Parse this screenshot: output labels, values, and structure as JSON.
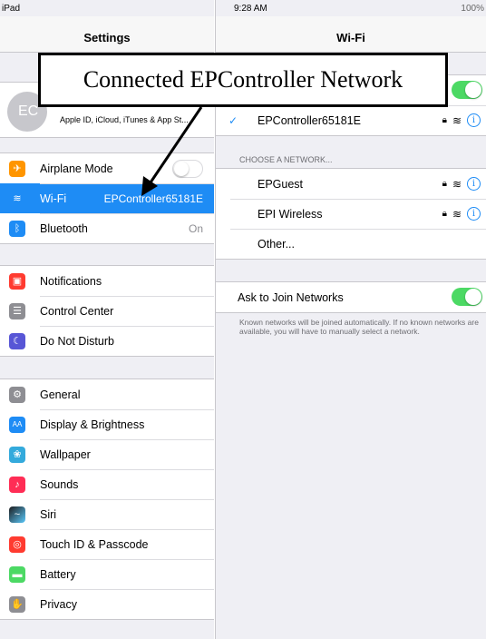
{
  "status_bar": {
    "carrier": "iPad",
    "time": "9:28 AM",
    "battery": "100%"
  },
  "left": {
    "title": "Settings",
    "profile": {
      "initials": "EC",
      "subtitle": "Apple ID, iCloud, iTunes & App St..."
    },
    "group1": [
      {
        "label": "Airplane Mode",
        "icon": "airplane-icon",
        "color": "#ff9500",
        "toggle": "off"
      },
      {
        "label": "Wi-Fi",
        "icon": "wifi-icon",
        "color": "#1e8cf5",
        "value": "EPController65181E",
        "selected": true
      },
      {
        "label": "Bluetooth",
        "icon": "bluetooth-icon",
        "color": "#1e8cf5",
        "value": "On"
      }
    ],
    "group2": [
      {
        "label": "Notifications",
        "icon": "notifications-icon",
        "color": "#ff3b30"
      },
      {
        "label": "Control Center",
        "icon": "control-center-icon",
        "color": "#8e8e93"
      },
      {
        "label": "Do Not Disturb",
        "icon": "moon-icon",
        "color": "#5856d6"
      }
    ],
    "group3": [
      {
        "label": "General",
        "icon": "gear-icon",
        "color": "#8e8e93"
      },
      {
        "label": "Display & Brightness",
        "icon": "display-icon",
        "color": "#1e8cf5"
      },
      {
        "label": "Wallpaper",
        "icon": "wallpaper-icon",
        "color": "#34aadc"
      },
      {
        "label": "Sounds",
        "icon": "sounds-icon",
        "color": "#ff2d55"
      },
      {
        "label": "Siri",
        "icon": "siri-icon",
        "color": "#1c1c1e"
      },
      {
        "label": "Touch ID & Passcode",
        "icon": "fingerprint-icon",
        "color": "#ff3b30"
      },
      {
        "label": "Battery",
        "icon": "battery-icon",
        "color": "#4cd964"
      },
      {
        "label": "Privacy",
        "icon": "hand-icon",
        "color": "#8e8e93"
      }
    ]
  },
  "right": {
    "title": "Wi-Fi",
    "connected_network": "EPController65181E",
    "choose_header": "CHOOSE A NETWORK...",
    "networks": [
      "EPGuest",
      "EPI Wireless"
    ],
    "other": "Other...",
    "ask_to_join": "Ask to Join Networks",
    "footnote": "Known networks will be joined automatically. If no known networks are available, you will have to manually select a network."
  },
  "callout": {
    "text": "Connected EPController Network"
  }
}
